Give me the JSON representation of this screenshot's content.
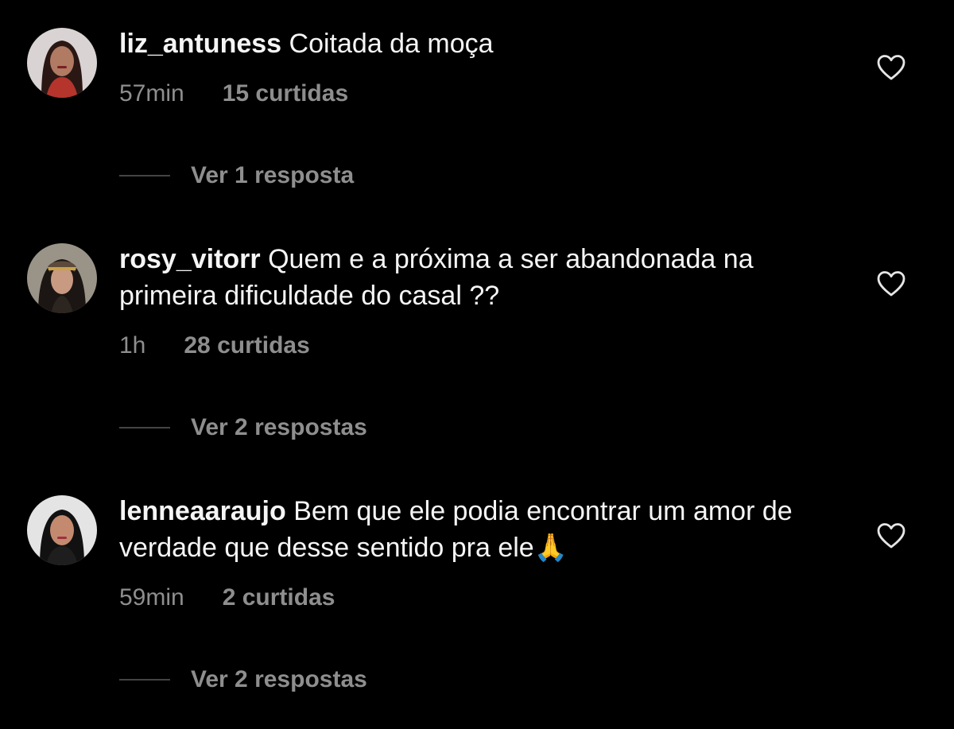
{
  "colors": {
    "background": "#000000",
    "text": "#f5f5f5",
    "secondary_text": "#8e8e8e",
    "divider": "#444444"
  },
  "comments": [
    {
      "username": "liz_antuness",
      "text": "Coitada da moça",
      "time": "57min",
      "likes": "15 curtidas",
      "replies": "Ver 1 resposta",
      "icon": "heart-outline-icon"
    },
    {
      "username": "rosy_vitorr",
      "text": "Quem e a próxima a ser abandonada na primeira dificuldade do casal ??",
      "time": "1h",
      "likes": "28 curtidas",
      "replies": "Ver 2 respostas",
      "icon": "heart-outline-icon"
    },
    {
      "username": "lenneaaraujo",
      "text": "Bem que ele podia encontrar um amor de verdade que desse sentido pra ele🙏",
      "time": "59min",
      "likes": "2 curtidas",
      "replies": "Ver 2 respostas",
      "icon": "heart-outline-icon"
    }
  ]
}
